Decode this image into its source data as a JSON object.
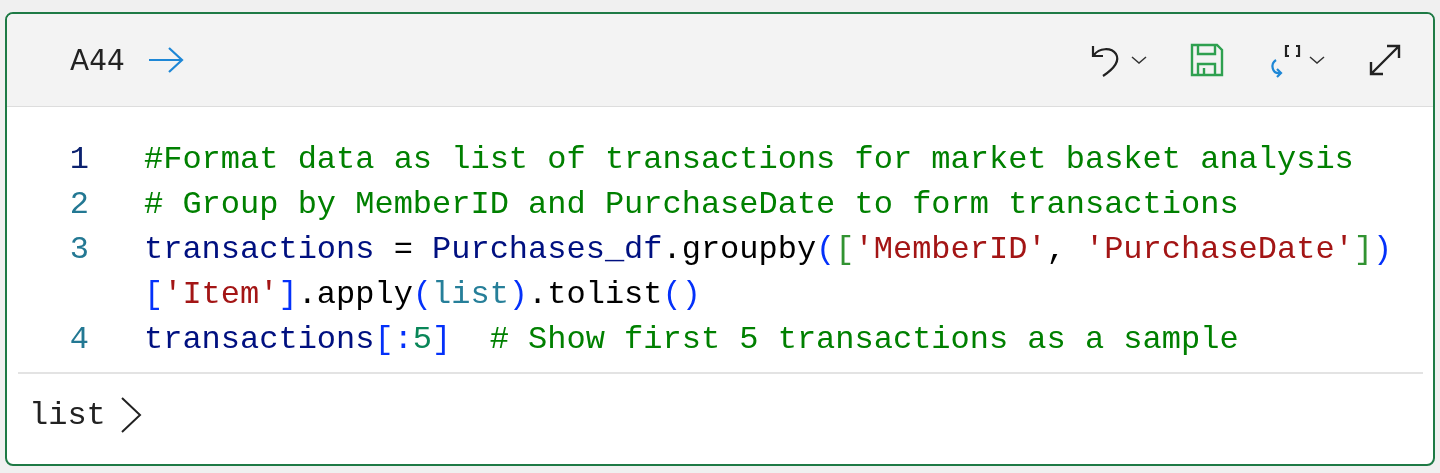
{
  "cell": {
    "label": "A44",
    "lines": [
      {
        "number": "1",
        "current": true,
        "tokens": [
          {
            "kind": "comment",
            "text": "#Format data as list of transactions for market basket analysis"
          }
        ]
      },
      {
        "number": "2",
        "current": false,
        "tokens": [
          {
            "kind": "comment",
            "text": "# Group by MemberID and PurchaseDate to form transactions"
          }
        ]
      },
      {
        "number": "3",
        "current": false,
        "tokens": [
          {
            "kind": "variable",
            "text": "transactions"
          },
          {
            "kind": "plain",
            "text": " = "
          },
          {
            "kind": "variable",
            "text": "Purchases_df"
          },
          {
            "kind": "plain",
            "text": ".groupby"
          },
          {
            "kind": "bracket",
            "text": "("
          },
          {
            "kind": "bracket2",
            "text": "["
          },
          {
            "kind": "string",
            "text": "'MemberID'"
          },
          {
            "kind": "plain",
            "text": ", "
          },
          {
            "kind": "string",
            "text": "'PurchaseDate'"
          },
          {
            "kind": "bracket2",
            "text": "]"
          },
          {
            "kind": "bracket",
            "text": ")"
          },
          {
            "kind": "bracket",
            "text": "["
          },
          {
            "kind": "string",
            "text": "'Item'"
          },
          {
            "kind": "bracket",
            "text": "]"
          },
          {
            "kind": "plain",
            "text": ".apply"
          },
          {
            "kind": "bracket",
            "text": "("
          },
          {
            "kind": "builtin",
            "text": "list"
          },
          {
            "kind": "bracket",
            "text": ")"
          },
          {
            "kind": "plain",
            "text": ".tolist"
          },
          {
            "kind": "bracket",
            "text": "()"
          }
        ]
      },
      {
        "number": "4",
        "current": false,
        "tokens": [
          {
            "kind": "variable",
            "text": "transactions"
          },
          {
            "kind": "bracket",
            "text": "[:"
          },
          {
            "kind": "number",
            "text": "5"
          },
          {
            "kind": "bracket",
            "text": "]"
          },
          {
            "kind": "comment",
            "text": "  # Show first 5 transactions as a sample"
          }
        ]
      }
    ],
    "output": {
      "text": "list",
      "expanded": false
    }
  }
}
